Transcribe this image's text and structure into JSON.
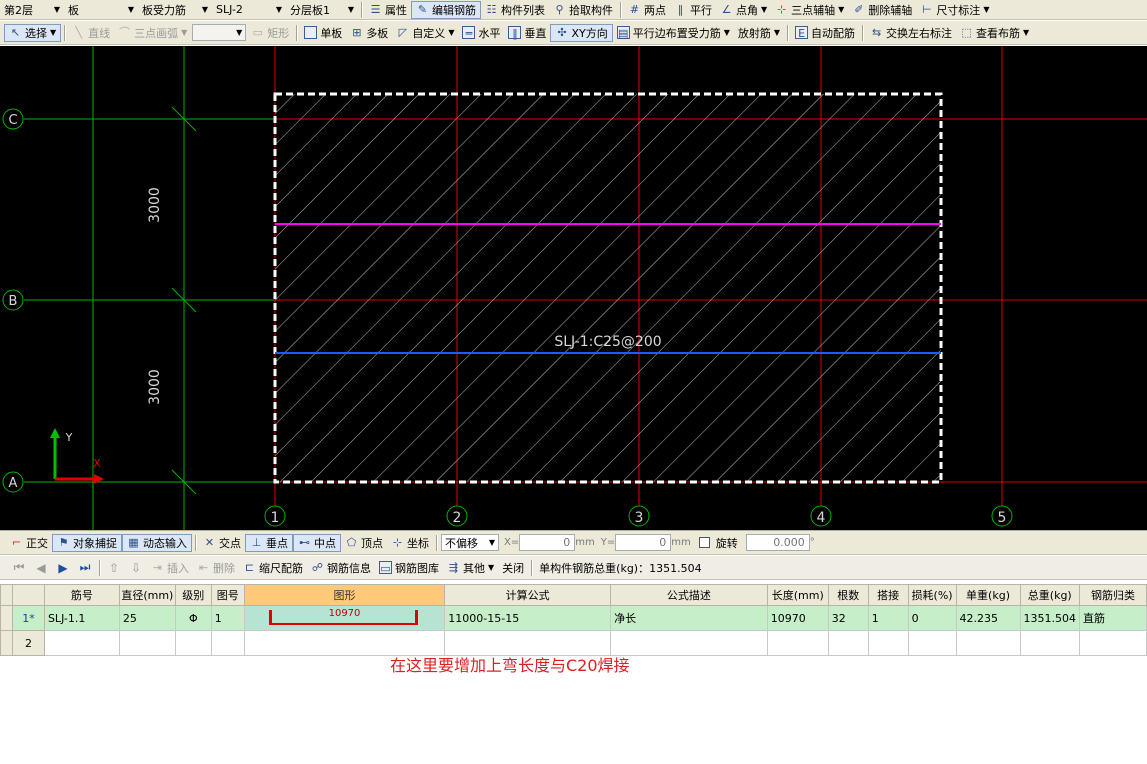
{
  "toolbar1": {
    "floor": "第2层",
    "component_type": "板",
    "rebar_type": "板受力筋",
    "component_name": "SLJ-2",
    "sublayer": "分层板1",
    "attributes": "属性",
    "edit_rebar": "编辑钢筋",
    "component_list": "构件列表",
    "pick_component": "拾取构件",
    "two_points": "两点",
    "parallel": "平行",
    "point_angle": "点角",
    "three_point_axis": "三点辅轴",
    "delete_axis": "删除辅轴",
    "dimension": "尺寸标注"
  },
  "toolbar2": {
    "select": "选择",
    "line": "直线",
    "arc": "三点画弧",
    "rect": "矩形",
    "single_board": "单板",
    "multi_board": "多板",
    "custom": "自定义",
    "horizontal": "水平",
    "vertical": "垂直",
    "xy_direction": "XY方向",
    "parallel_edge": "平行边布置受力筋",
    "radial": "放射筋",
    "auto_rebar": "自动配筋",
    "swap_label": "交换左右标注",
    "view_layout": "查看布筋"
  },
  "canvas": {
    "axis_rows": [
      "C",
      "B",
      "A"
    ],
    "axis_cols": [
      "1",
      "2",
      "3",
      "4",
      "5"
    ],
    "dimensions": [
      "3000",
      "3000"
    ],
    "rebar_label": "SLJ-1:C25@200",
    "ucs_x": "X",
    "ucs_y": "Y"
  },
  "toolbar3": {
    "ortho": "正交",
    "snap": "对象捕捉",
    "dynamic_input": "动态输入",
    "intersection": "交点",
    "perpendicular": "垂点",
    "midpoint": "中点",
    "vertex": "顶点",
    "coordinate": "坐标",
    "offset_mode": "不偏移",
    "x_label": "X=",
    "x_value": "0",
    "y_label": "Y=",
    "y_value": "0",
    "unit": "mm",
    "rotate": "旋转",
    "rotate_value": "0.000",
    "degree": "°"
  },
  "toolbar4": {
    "insert": "插入",
    "delete": "删除",
    "scale_rebar": "缩尺配筋",
    "rebar_info": "钢筋信息",
    "rebar_library": "钢筋图库",
    "other": "其他",
    "close": "关闭",
    "total_weight_label": "单构件钢筋总重(kg)：1351.504"
  },
  "table": {
    "headers": [
      "筋号",
      "直径(mm)",
      "级别",
      "图号",
      "图形",
      "计算公式",
      "公式描述",
      "长度(mm)",
      "根数",
      "搭接",
      "损耗(%)",
      "单重(kg)",
      "总重(kg)",
      "钢筋归类"
    ],
    "rows": [
      {
        "index": "1*",
        "name": "SLJ-1.1",
        "diameter": "25",
        "grade": "Φ",
        "figure_no": "1",
        "shape_value": "10970",
        "formula": "11000-15-15",
        "formula_desc": "净长",
        "length": "10970",
        "count": "32",
        "lap": "1",
        "loss": "0",
        "unit_weight": "42.235",
        "total_weight": "1351.504",
        "category": "直筋"
      },
      {
        "index": "2"
      }
    ]
  },
  "note": "在这里要增加上弯长度与C20焊接",
  "colors": {
    "grid_green": "#00b300",
    "grid_red": "#e00000",
    "rebar_magenta": "#ff00ff",
    "rebar_blue": "#1e5cff",
    "selected_row": "#c6eec8",
    "highlight_header": "#ffc979"
  }
}
